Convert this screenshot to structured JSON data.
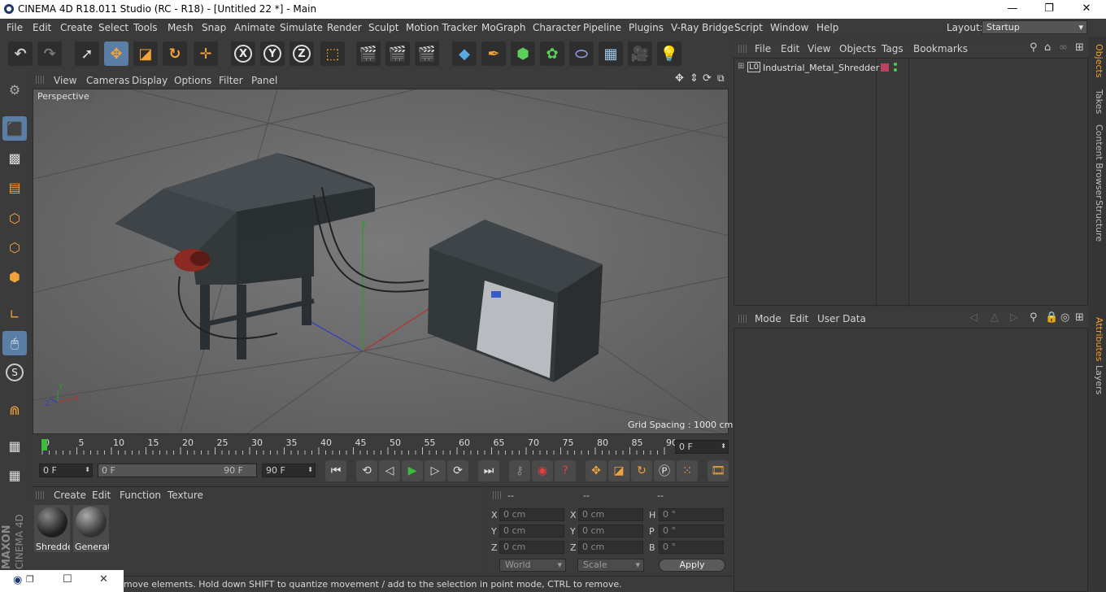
{
  "window": {
    "title": "CINEMA 4D R18.011 Studio (RC - R18) - [Untitled 22 *] - Main",
    "minimize_glyph": "—",
    "restore_glyph": "❐",
    "close_glyph": "✕"
  },
  "menubar": {
    "items": [
      "File",
      "Edit",
      "Create",
      "Select",
      "Tools",
      "Mesh",
      "Snap",
      "Animate",
      "Simulate",
      "Render",
      "Sculpt",
      "Motion Tracker",
      "MoGraph",
      "Character",
      "Pipeline",
      "Plugins",
      "V-Ray Bridge",
      "Script",
      "Window",
      "Help"
    ],
    "layout_label": "Layout:",
    "layout_value": "Startup"
  },
  "toolbar": {
    "axis_x": "X",
    "axis_y": "Y",
    "axis_z": "Z"
  },
  "viewport": {
    "menu": [
      "View",
      "Cameras",
      "Display",
      "Options",
      "Filter",
      "Panel"
    ],
    "label": "Perspective",
    "grid_spacing": "Grid Spacing : 1000 cm",
    "axis_y": "Y",
    "axis_x": "X",
    "axis_z": "Z"
  },
  "timeline": {
    "ticks": [
      "0",
      "5",
      "10",
      "15",
      "20",
      "25",
      "30",
      "35",
      "40",
      "45",
      "50",
      "55",
      "60",
      "65",
      "70",
      "75",
      "80",
      "85",
      "90"
    ],
    "current_frame": "0 F"
  },
  "transport": {
    "start_field": "0 F",
    "range_start": "0 F",
    "range_end": "90 F",
    "end_field": "90 F"
  },
  "materials": {
    "menu": [
      "Create",
      "Edit",
      "Function",
      "Texture"
    ],
    "items": [
      {
        "label": "Shredde"
      },
      {
        "label": "Generat"
      }
    ]
  },
  "coordinates": {
    "headers": [
      "--",
      "--",
      "--"
    ],
    "rows": [
      {
        "l1": "X",
        "v1": "0 cm",
        "l2": "X",
        "v2": "0 cm",
        "l3": "H",
        "v3": "0 °"
      },
      {
        "l1": "Y",
        "v1": "0 cm",
        "l2": "Y",
        "v2": "0 cm",
        "l3": "P",
        "v3": "0 °"
      },
      {
        "l1": "Z",
        "v1": "0 cm",
        "l2": "Z",
        "v2": "0 cm",
        "l3": "B",
        "v3": "0 °"
      }
    ],
    "mode_world": "World",
    "mode_scale": "Scale",
    "apply": "Apply"
  },
  "status": {
    "text": "move elements. Hold down SHIFT to quantize movement / add to the selection in point mode, CTRL to remove."
  },
  "objects": {
    "menu": [
      "File",
      "Edit",
      "View",
      "Objects",
      "Tags",
      "Bookmarks"
    ],
    "tree": [
      {
        "name": "Industrial_Metal_Shredder",
        "layer_tag": "L0"
      }
    ]
  },
  "attributes": {
    "menu": [
      "Mode",
      "Edit",
      "User Data"
    ]
  },
  "side_tabs": [
    "Objects",
    "Takes",
    "Content Browser",
    "Structure",
    "Attributes",
    "Layers"
  ],
  "brand": {
    "line1": "MAXON",
    "line2": "CINEMA 4D"
  },
  "colors": {
    "accent": "#5a7ea6",
    "tab_active": "#f0a030",
    "play": "#3dbd3d"
  }
}
